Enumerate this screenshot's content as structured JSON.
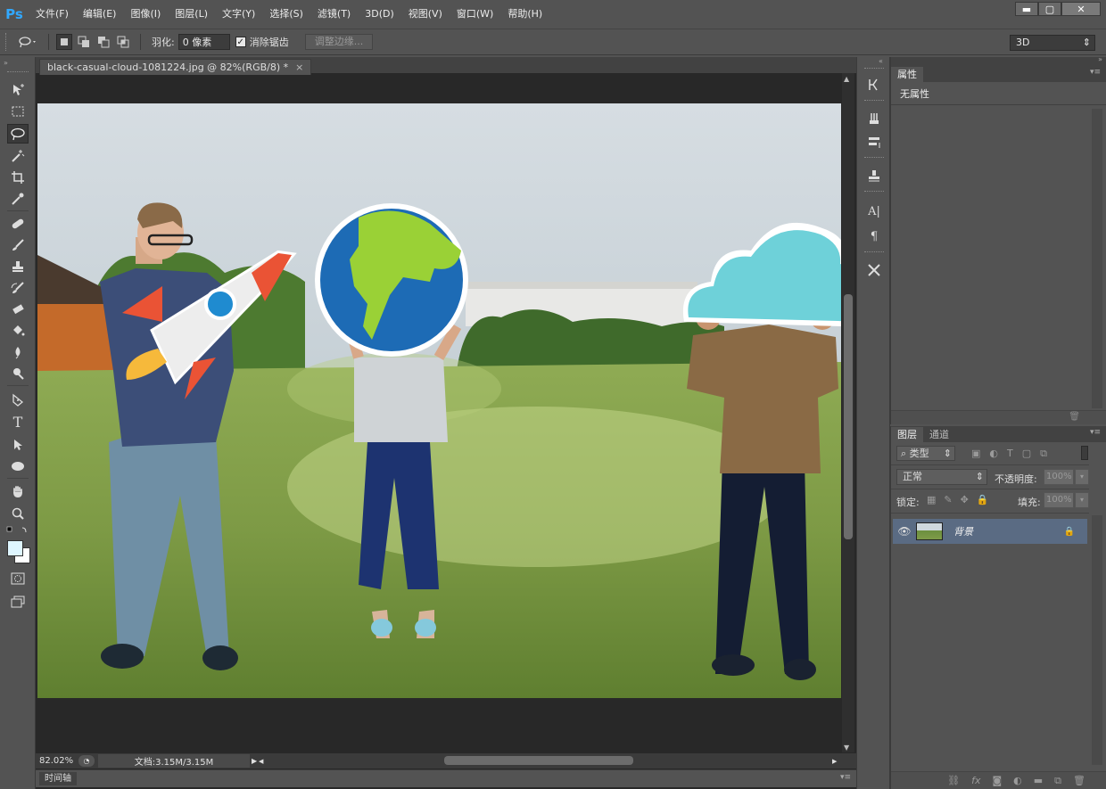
{
  "app": {
    "logo": "Ps"
  },
  "menu": [
    "文件(F)",
    "编辑(E)",
    "图像(I)",
    "图层(L)",
    "文字(Y)",
    "选择(S)",
    "滤镜(T)",
    "3D(D)",
    "视图(V)",
    "窗口(W)",
    "帮助(H)"
  ],
  "window_controls": {
    "minimize": "▬",
    "maximize": "▢",
    "close": "✕"
  },
  "options": {
    "feather_label": "羽化:",
    "feather_value": "0 像素",
    "antialias_label": "消除锯齿",
    "antialias_checked": true,
    "refine_edge_button": "调整边缘...",
    "workspace_value": "3D"
  },
  "document": {
    "tab_title": "black-casual-cloud-1081224.jpg @ 82%(RGB/8) *",
    "tab_close": "×"
  },
  "status": {
    "zoom": "82.02%",
    "doc_info": "文档:3.15M/3.15M"
  },
  "timeline": {
    "label": "时间轴"
  },
  "properties_panel": {
    "tab": "属性",
    "content": "无属性"
  },
  "layers_panel": {
    "tabs": [
      "图层",
      "通道"
    ],
    "filter_kind": "类型",
    "blend_mode": "正常",
    "opacity_label": "不透明度:",
    "opacity_value": "100%",
    "lock_label": "锁定:",
    "fill_label": "填充:",
    "fill_value": "100%",
    "layers": [
      {
        "name": "背景",
        "visible": true,
        "locked": true
      }
    ]
  },
  "colors": {
    "accent_ps": "#31a8ff",
    "ui_bg": "#535353",
    "canvas_bg": "#282828",
    "layer_selected": "#5a6b83"
  }
}
